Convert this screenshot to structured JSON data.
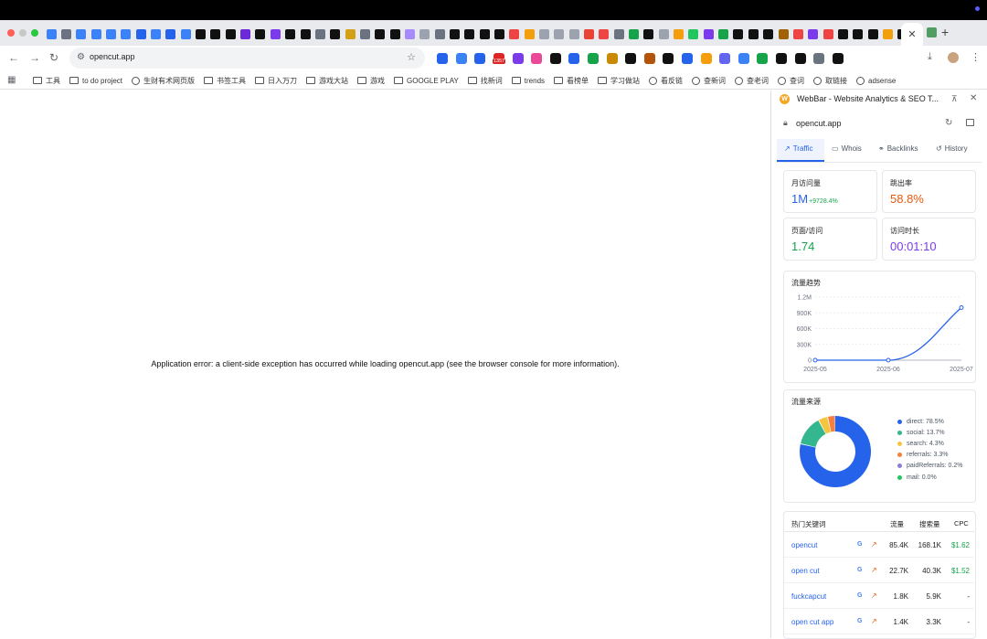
{
  "tabstrip": {
    "favicons": [
      "#3b82f6",
      "#6b7280",
      "#3b82f6",
      "#3b82f6",
      "#3b82f6",
      "#3b82f6",
      "#2563eb",
      "#3b82f6",
      "#2563eb",
      "#3b82f6",
      "#111111",
      "#111111",
      "#111111",
      "#6d28d9",
      "#111111",
      "#7c3aed",
      "#111111",
      "#111111",
      "#6b7280",
      "#111111",
      "#d4a017",
      "#6b7280",
      "#111111",
      "#111111",
      "#a78bfa",
      "#9ca3af",
      "#6b7280",
      "#111111",
      "#111111",
      "#111111",
      "#111111",
      "#ef4444",
      "#f59e0b",
      "#9ca3af",
      "#9ca3af",
      "#9ca3af",
      "#ea4335",
      "#ef4444",
      "#6b7280",
      "#16a34a",
      "#111111",
      "#9ca3af",
      "#f59e0b",
      "#22c55e",
      "#7c3aed",
      "#16a34a",
      "#111111",
      "#111111",
      "#111111",
      "#a16207",
      "#ef4444",
      "#7c3aed",
      "#ef4444",
      "#111111",
      "#111111",
      "#111111",
      "#f59e0b",
      "#111111"
    ],
    "active_tab_close": "✕",
    "new_tab": "+"
  },
  "toolbar": {
    "url": "opencut.app",
    "ext_icons": [
      "#2563eb",
      "#3b82f6",
      "#2563eb",
      "#dc2626",
      "#7c3aed",
      "#ec4899",
      "#111111",
      "#2563eb",
      "#16a34a",
      "#ca8a04",
      "#111111",
      "#b45309",
      "#111111",
      "#2563eb",
      "#f59e0b",
      "#6366f1",
      "#3b82f6",
      "#16a34a",
      "#111111",
      "#111111",
      "#6b7280",
      "#111111"
    ],
    "ext_badge": "1357"
  },
  "bookmarks": [
    {
      "label": "工具",
      "icon": "folder"
    },
    {
      "label": "to do project",
      "icon": "folder"
    },
    {
      "label": "生财有术网页版",
      "icon": "globe"
    },
    {
      "label": "书签工具",
      "icon": "folder"
    },
    {
      "label": "日入万刀",
      "icon": "folder"
    },
    {
      "label": "游戏大站",
      "icon": "folder"
    },
    {
      "label": "游戏",
      "icon": "folder"
    },
    {
      "label": "GOOGLE PLAY",
      "icon": "folder"
    },
    {
      "label": "找新词",
      "icon": "folder"
    },
    {
      "label": "trends",
      "icon": "folder"
    },
    {
      "label": "看榜单",
      "icon": "folder"
    },
    {
      "label": "学习做站",
      "icon": "folder"
    },
    {
      "label": "看反链",
      "icon": "globe"
    },
    {
      "label": "查新词",
      "icon": "globe"
    },
    {
      "label": "查老词",
      "icon": "globe"
    },
    {
      "label": "查词",
      "icon": "globe"
    },
    {
      "label": "取链接",
      "icon": "globe"
    },
    {
      "label": "adsense",
      "icon": "globe"
    }
  ],
  "content": {
    "error": "Application error: a client-side exception has occurred while loading opencut.app (see the browser console for more information)."
  },
  "panel": {
    "title": "WebBar - Website Analytics & SEO T...",
    "domain": "opencut.app",
    "tabs": [
      "Traffic",
      "Whois",
      "Backlinks",
      "History"
    ],
    "stats": [
      {
        "label": "月访问量",
        "value": "1M",
        "change": "+9728.4%",
        "color": "#2563eb"
      },
      {
        "label": "跳出率",
        "value": "58.8%",
        "change": "",
        "color": "#ea580c"
      },
      {
        "label": "页面/访问",
        "value": "1.74",
        "change": "",
        "color": "#16a34a"
      },
      {
        "label": "访问时长",
        "value": "00:01:10",
        "change": "",
        "color": "#7c3aed"
      }
    ],
    "trend_title": "流量趋势",
    "sources_title": "流量来源",
    "keywords": {
      "headers": [
        "热门关键词",
        "流量",
        "搜索量",
        "CPC"
      ],
      "rows": [
        {
          "keyword": "opencut",
          "traffic": "85.4K",
          "volume": "168.1K",
          "cpc": "$1.62",
          "cpc_color": "#16a34a"
        },
        {
          "keyword": "open cut",
          "traffic": "22.7K",
          "volume": "40.3K",
          "cpc": "$1.52",
          "cpc_color": "#16a34a"
        },
        {
          "keyword": "fuckcapcut",
          "traffic": "1.8K",
          "volume": "5.9K",
          "cpc": "-",
          "cpc_color": "#1f1f1f"
        },
        {
          "keyword": "open cut app",
          "traffic": "1.4K",
          "volume": "3.3K",
          "cpc": "-",
          "cpc_color": "#1f1f1f"
        }
      ]
    }
  },
  "chart_data": [
    {
      "type": "line",
      "x": [
        "2025-05",
        "2025-06",
        "2025-07"
      ],
      "y": [
        0,
        0,
        1000000
      ],
      "yticks": [
        "0",
        "300K",
        "600K",
        "900K",
        "1.2M"
      ],
      "ylim": [
        0,
        1200000
      ],
      "grid": true,
      "color": "#2563eb"
    },
    {
      "type": "pie",
      "donut": true,
      "categories": [
        "direct",
        "social",
        "search",
        "referrals",
        "paidReferrals",
        "mail"
      ],
      "values": [
        78.5,
        13.7,
        4.3,
        3.3,
        0.2,
        0.0
      ],
      "labels": [
        "direct: 78.5%",
        "social: 13.7%",
        "search: 4.3%",
        "referrals: 3.3%",
        "paidReferrals: 0.2%",
        "mail: 0.0%"
      ],
      "colors": [
        "#2563eb",
        "#34b78f",
        "#f5c542",
        "#f97f3c",
        "#8b7fd6",
        "#22c55e"
      ],
      "legend": "right"
    }
  ]
}
